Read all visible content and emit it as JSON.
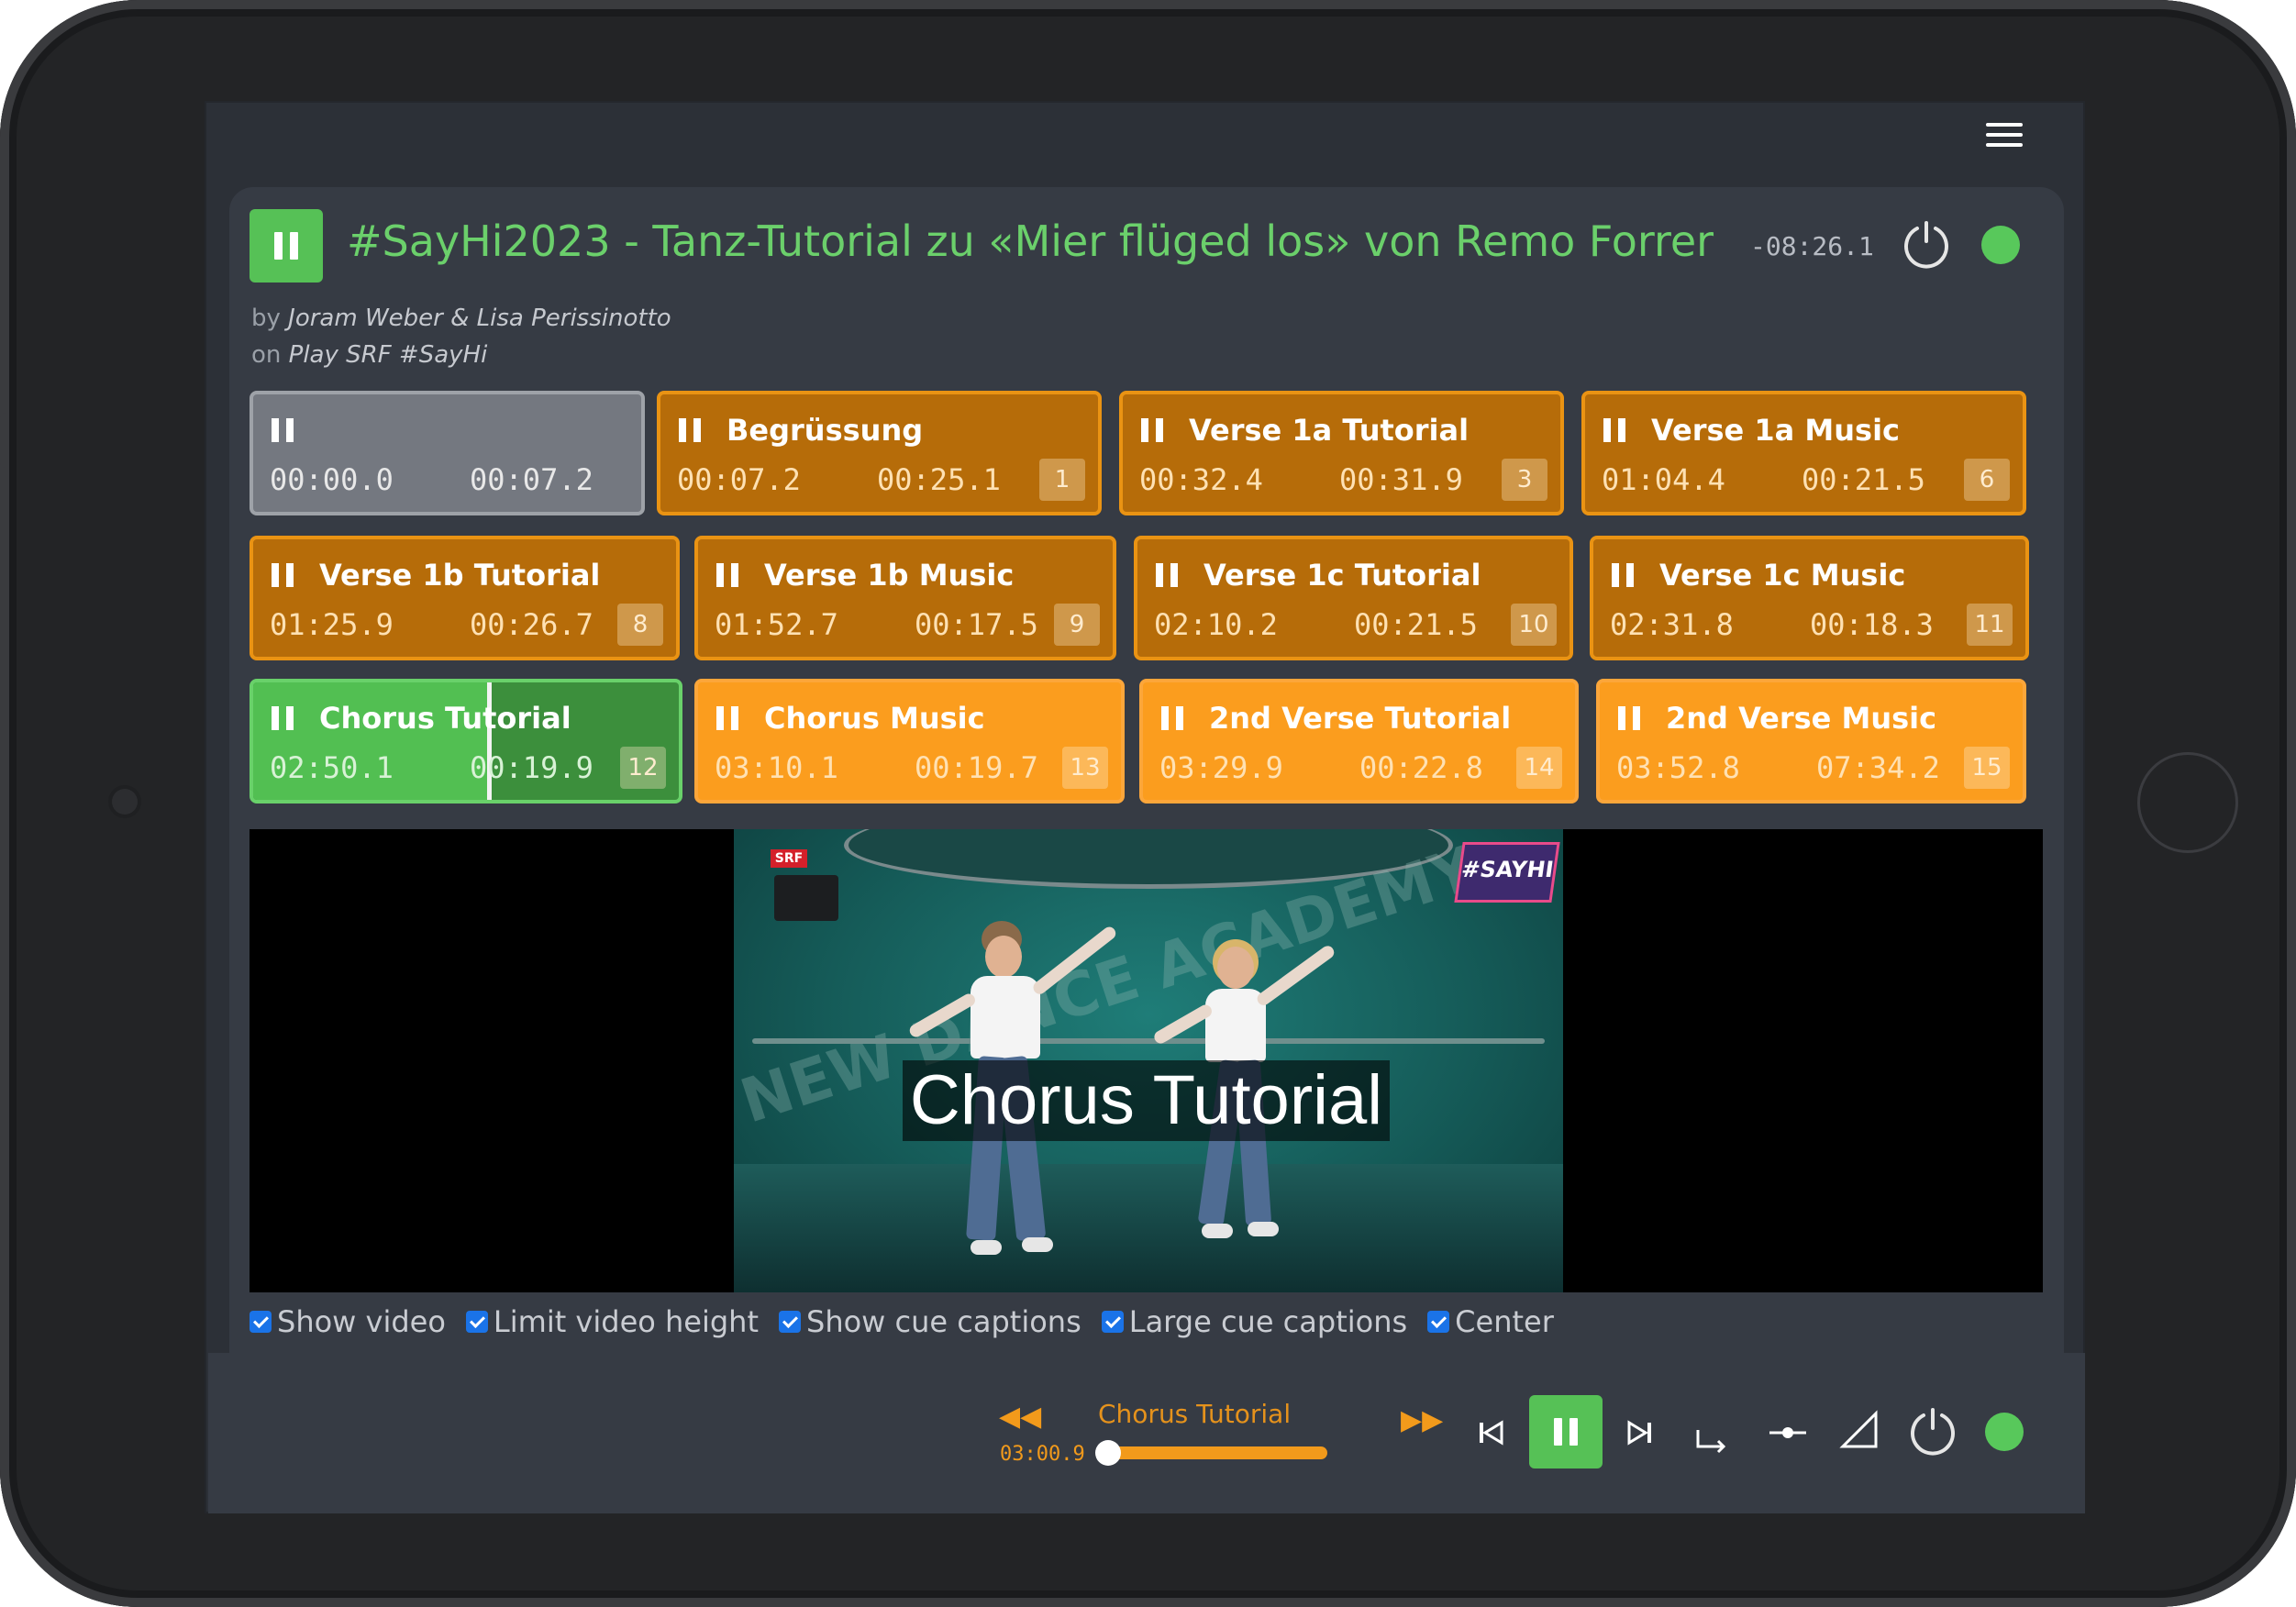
{
  "header": {
    "menu_icon": "hamburger-menu-icon"
  },
  "track": {
    "title": "#SayHi2023 - Tanz-Tutorial zu «Mier flüged los» von Remo Forrer",
    "remaining_time": "-08:26.1",
    "artist_prefix": "by",
    "artist": "Joram Weber & Lisa Perissinotto",
    "album_prefix": "on",
    "album": "Play SRF #SayHi",
    "status_color": "#58c85b"
  },
  "cues": [
    {
      "name": "",
      "start": "00:00.0",
      "duration": "00:07.2",
      "number": "",
      "state": "gray"
    },
    {
      "name": "Begrüssung",
      "start": "00:07.2",
      "duration": "00:25.1",
      "number": "1",
      "state": "dim"
    },
    {
      "name": "Verse 1a Tutorial",
      "start": "00:32.4",
      "duration": "00:31.9",
      "number": "3",
      "state": "dim"
    },
    {
      "name": "Verse 1a Music",
      "start": "01:04.4",
      "duration": "00:21.5",
      "number": "6",
      "state": "dim"
    },
    {
      "name": "Verse 1b Tutorial",
      "start": "01:25.9",
      "duration": "00:26.7",
      "number": "8",
      "state": "dim"
    },
    {
      "name": "Verse 1b Music",
      "start": "01:52.7",
      "duration": "00:17.5",
      "number": "9",
      "state": "dim"
    },
    {
      "name": "Verse 1c Tutorial",
      "start": "02:10.2",
      "duration": "00:21.5",
      "number": "10",
      "state": "dim"
    },
    {
      "name": "Verse 1c Music",
      "start": "02:31.8",
      "duration": "00:18.3",
      "number": "11",
      "state": "dim"
    },
    {
      "name": "Chorus Tutorial",
      "start": "02:50.1",
      "duration": "00:19.9",
      "number": "12",
      "state": "active",
      "progress": 0.54
    },
    {
      "name": "Chorus Music",
      "start": "03:10.1",
      "duration": "00:19.7",
      "number": "13",
      "state": "bright"
    },
    {
      "name": "2nd Verse Tutorial",
      "start": "03:29.9",
      "duration": "00:22.8",
      "number": "14",
      "state": "bright"
    },
    {
      "name": "2nd Verse Music",
      "start": "03:52.8",
      "duration": "07:34.2",
      "number": "15",
      "state": "bright"
    }
  ],
  "video": {
    "caption": "Chorus Tutorial",
    "logo_srf": "SRF",
    "logo_sayhi": "#SAYHI",
    "wall_text": "NEW DANCE ACADEMY"
  },
  "options": [
    {
      "label": "Show video",
      "checked": true
    },
    {
      "label": "Limit video height",
      "checked": true
    },
    {
      "label": "Show cue captions",
      "checked": true
    },
    {
      "label": "Large cue captions",
      "checked": true
    },
    {
      "label": "Center",
      "checked": true
    }
  ],
  "transport": {
    "current_cue": "Chorus Tutorial",
    "current_time": "03:00.9",
    "cue_progress": 0.05,
    "accent_color": "#f29a1b",
    "play_color": "#56c156"
  }
}
